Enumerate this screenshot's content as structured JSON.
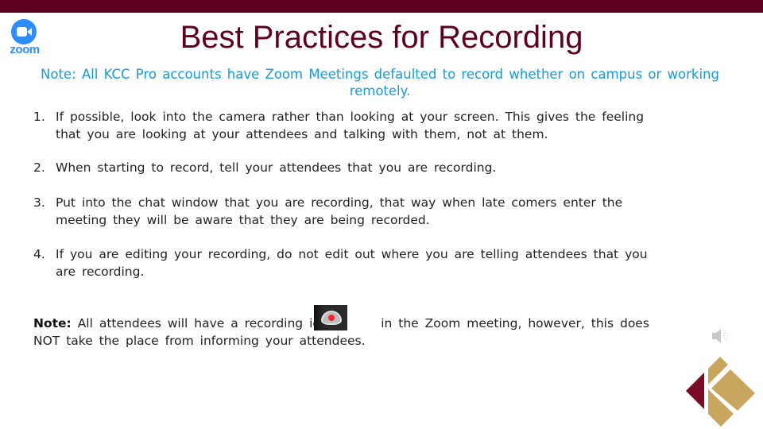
{
  "slide": {
    "title": "Best Practices for Recording",
    "logo_text": "zoom",
    "top_note": "Note: All KCC Pro accounts have Zoom Meetings defaulted to record whether on campus or working remotely.",
    "practices": [
      {
        "number": "1.",
        "text": "If possible, look into the camera rather than looking at your screen. This gives the feeling that you are looking at your attendees and talking with them, not at them."
      },
      {
        "number": "2.",
        "text": "When starting to record, tell your attendees that you are recording."
      },
      {
        "number": "3.",
        "text": "Put into the chat window that you are recording, that way when late comers enter the meeting they will be aware that they are being recorded."
      },
      {
        "number": "4.",
        "text": "If you are editing your recording, do not edit out where you are telling attendees that you are recording."
      }
    ],
    "bottom_note": {
      "label": "Note:",
      "text_before_icon": "All attendees will have a recording icon",
      "text_after_icon": "in the Zoom meeting, however, this does NOT take the place from informing your attendees."
    },
    "icons": {
      "brand": "zoom-logo",
      "recording": "recording-indicator-icon",
      "audio": "speaker-icon",
      "institution": "kcc-logo"
    },
    "colors": {
      "band": "#5f0020",
      "title": "#5f0020",
      "note": "#1a9ad6",
      "zoom_blue": "#2d8cff",
      "logo_maroon": "#7a0a26",
      "logo_tan": "#c9a65e"
    }
  }
}
